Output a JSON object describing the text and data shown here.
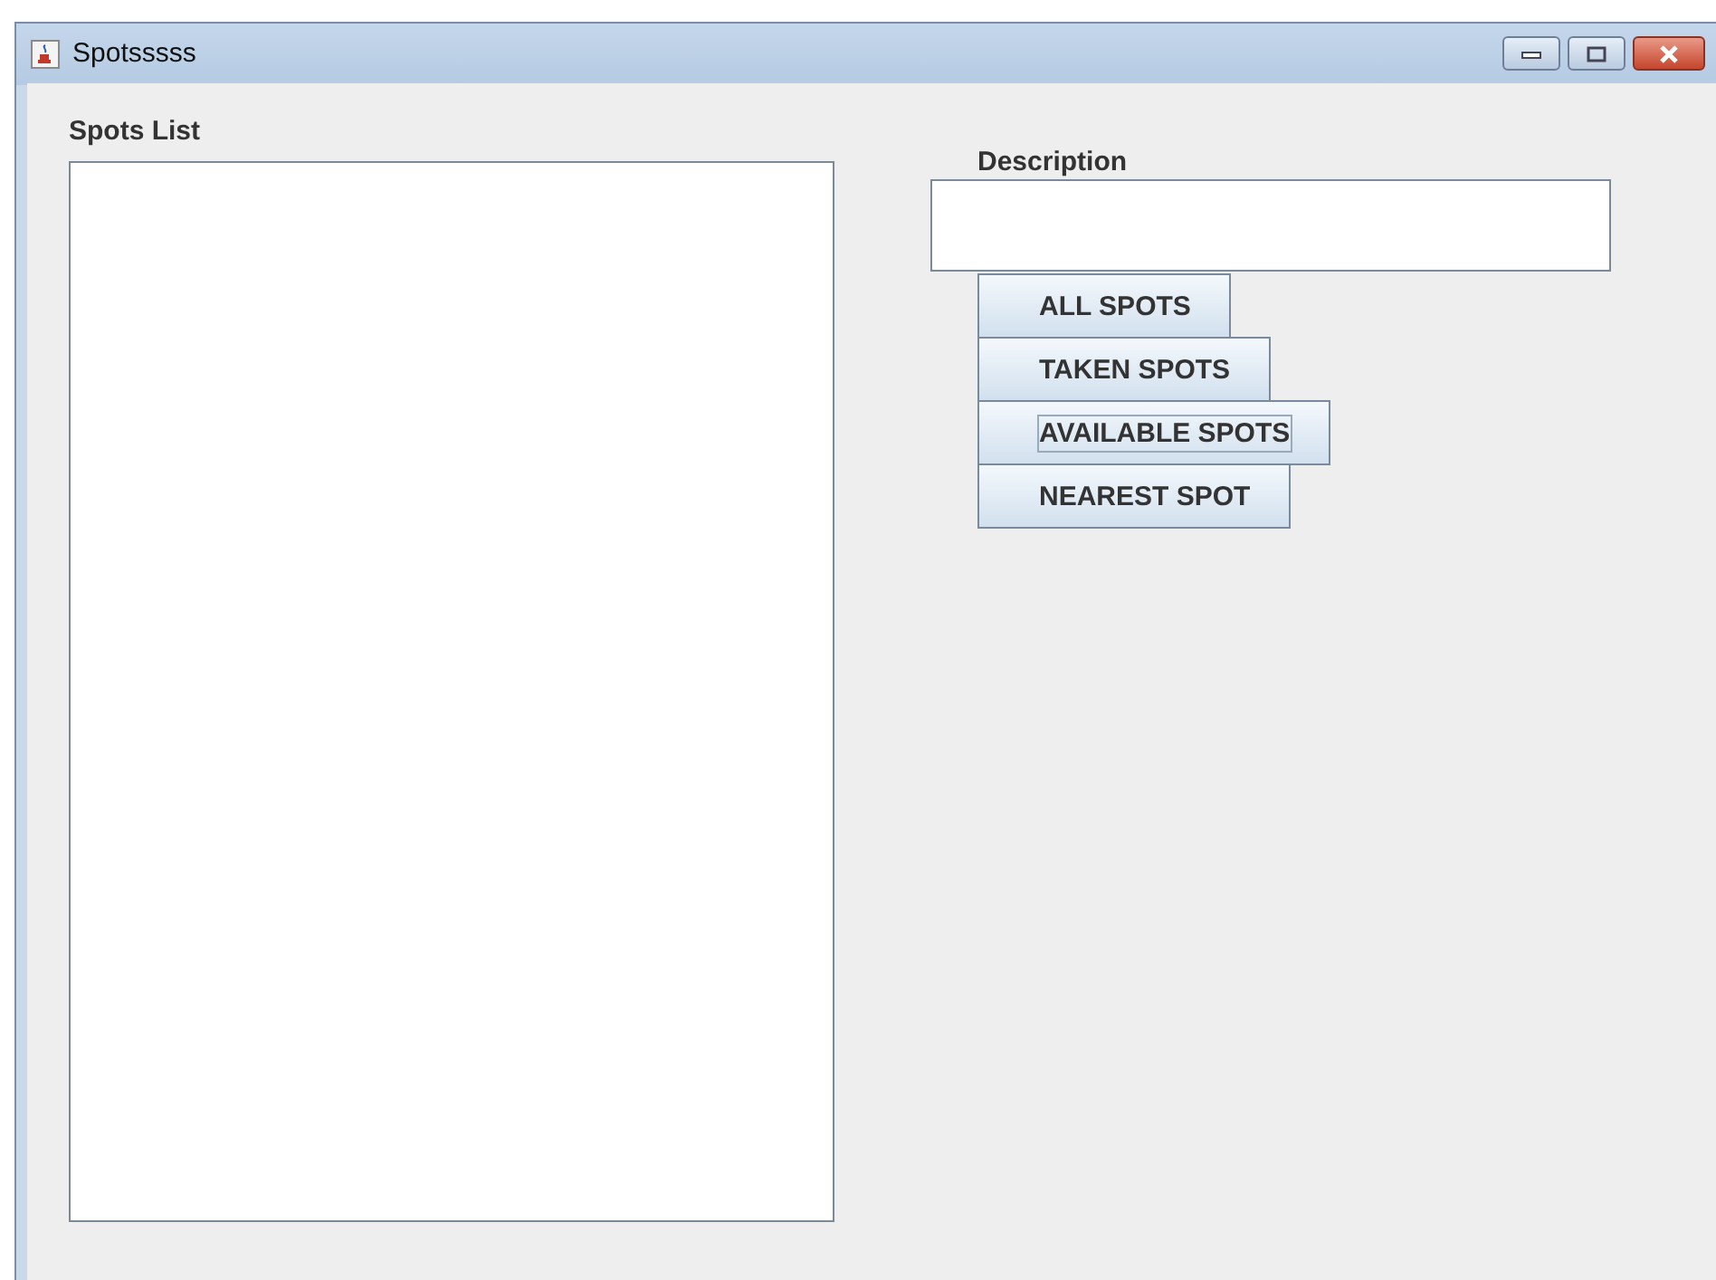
{
  "window": {
    "title": "Spotsssss"
  },
  "spots_list": {
    "label": "Spots List"
  },
  "description": {
    "label": "Description"
  },
  "buttons": [
    {
      "label": "ALL SPOTS",
      "focused": false
    },
    {
      "label": "TAKEN SPOTS",
      "focused": false
    },
    {
      "label": "AVAILABLE SPOTS",
      "focused": true
    },
    {
      "label": "NEAREST SPOT",
      "focused": false
    }
  ]
}
